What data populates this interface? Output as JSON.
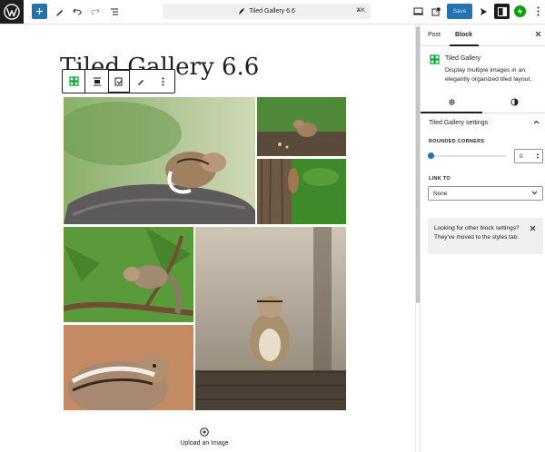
{
  "topbar": {
    "document_title": "Tiled Gallery 6.6",
    "shortcut": "⌘K",
    "save_label": "Save",
    "icons": [
      "wordpress-logo",
      "plus-icon",
      "pencil-icon",
      "undo-icon",
      "redo-icon",
      "list-view-icon",
      "feather-icon",
      "desktop-preview-icon",
      "external-link-icon",
      "publish-icon",
      "sidebar-icon",
      "jetpack-icon",
      "more-vertical-icon"
    ]
  },
  "editor": {
    "post_title": "Tiled Gallery 6.6",
    "block_toolbar_icons": [
      "tiled-gallery-icon",
      "align-icon",
      "media-replace-icon",
      "edit-pencil-icon",
      "more-options-icon"
    ],
    "gallery_images": [
      "chipmunk-on-rock",
      "chipmunk-on-ground",
      "squirrel-on-tree",
      "squirrel-on-branch",
      "chipmunk-on-log",
      "squirrel-eating"
    ],
    "upload_label": "Upload an Image"
  },
  "sidebar": {
    "tab_post": "Post",
    "tab_block": "Block",
    "block_name": "Tiled Gallery",
    "block_description": "Display multiple images in an elegantly organized tiled layout.",
    "panel_title": "Tiled Gallery settings",
    "rounded_corners_label": "ROUNDED CORNERS",
    "rounded_corners_value": "0",
    "link_to_label": "LINK TO",
    "link_to_value": "None",
    "notice_text": "Looking for other block settings? They've moved to the styles tab."
  },
  "colors": {
    "accent": "#2271b1",
    "dark": "#1e1e1e",
    "gallery_green": "#00a32a"
  }
}
